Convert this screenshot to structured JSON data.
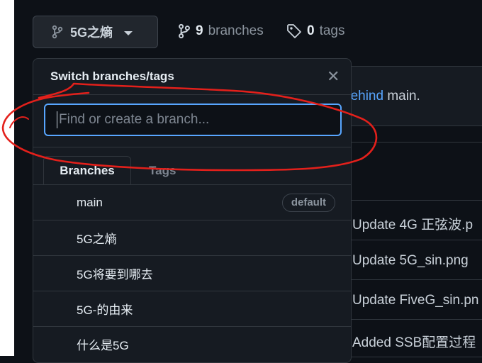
{
  "header": {
    "current_branch": "5G之熵",
    "branches_count": "9",
    "branches_label": "branches",
    "tags_count": "0",
    "tags_label": "tags"
  },
  "background": {
    "behind_link": "behind",
    "behind_rest": " main.",
    "commits": [
      "Update 4G 正弦波.p",
      "Update 5G_sin.png",
      "Update FiveG_sin.pn",
      "Added SSB配置过程"
    ]
  },
  "dropdown": {
    "title": "Switch branches/tags",
    "close_symbol": "✕",
    "search_placeholder": "Find or create a branch...",
    "tabs": [
      "Branches",
      "Tags"
    ],
    "default_badge": "default",
    "branches": [
      "main",
      "5G之熵",
      "5G将要到哪去",
      "5G-的由来",
      "什么是5G"
    ]
  },
  "colors": {
    "background": "#0d1117",
    "accent": "#58a6ff",
    "annotation": "#e3201b"
  }
}
